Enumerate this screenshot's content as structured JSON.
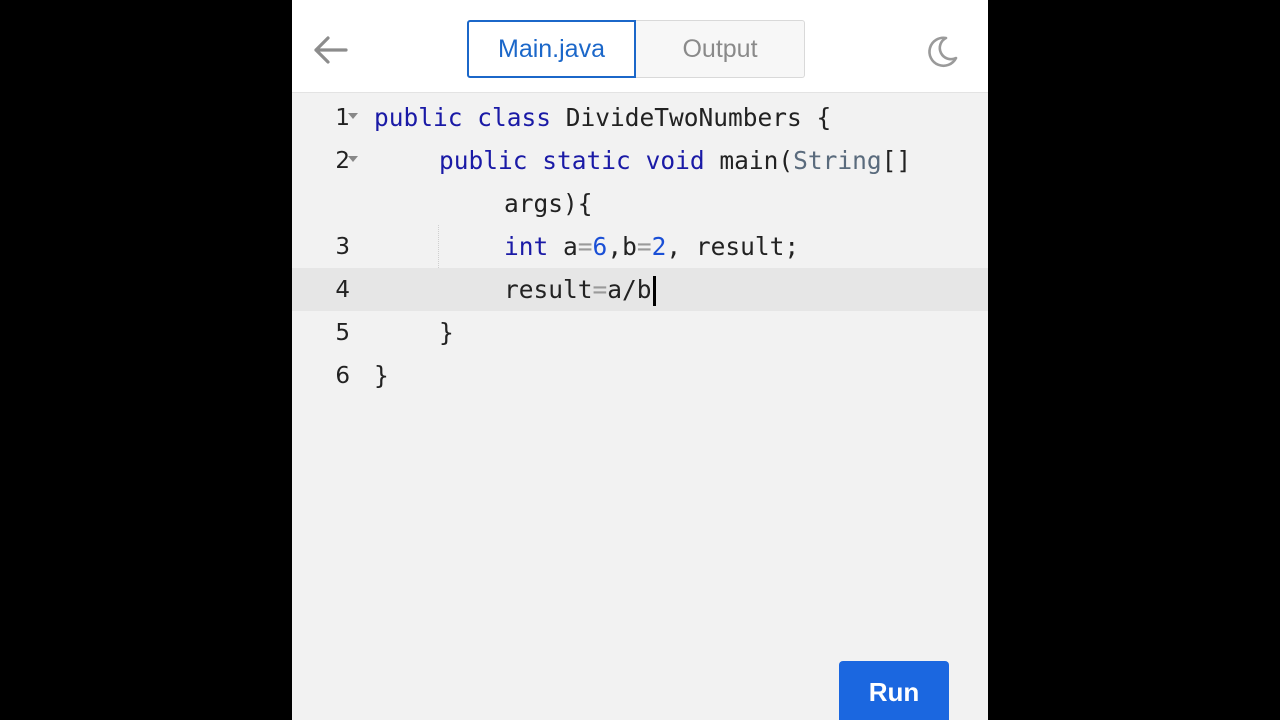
{
  "header": {
    "back_icon": "arrow-left-icon",
    "tabs": [
      {
        "label": "Main.java",
        "active": true
      },
      {
        "label": "Output",
        "active": false
      }
    ],
    "theme_icon": "moon-icon"
  },
  "editor": {
    "current_line": 4,
    "lines": [
      {
        "number": "1",
        "text": "public class DivideTwoNumbers {"
      },
      {
        "number": "2",
        "text": "public static void main(String[]"
      },
      {
        "number": "",
        "text": "args){"
      },
      {
        "number": "3",
        "text": "int a=6,b=2, result;"
      },
      {
        "number": "4",
        "text": "result=a/b"
      },
      {
        "number": "5",
        "text": "}"
      },
      {
        "number": "6",
        "text": "}"
      }
    ]
  },
  "footer": {
    "run_label": "Run"
  },
  "colors": {
    "accent": "#1b67c9",
    "run_button": "#1b67e0",
    "keyword": "#1a1aa6",
    "number": "#1a4fd6"
  }
}
